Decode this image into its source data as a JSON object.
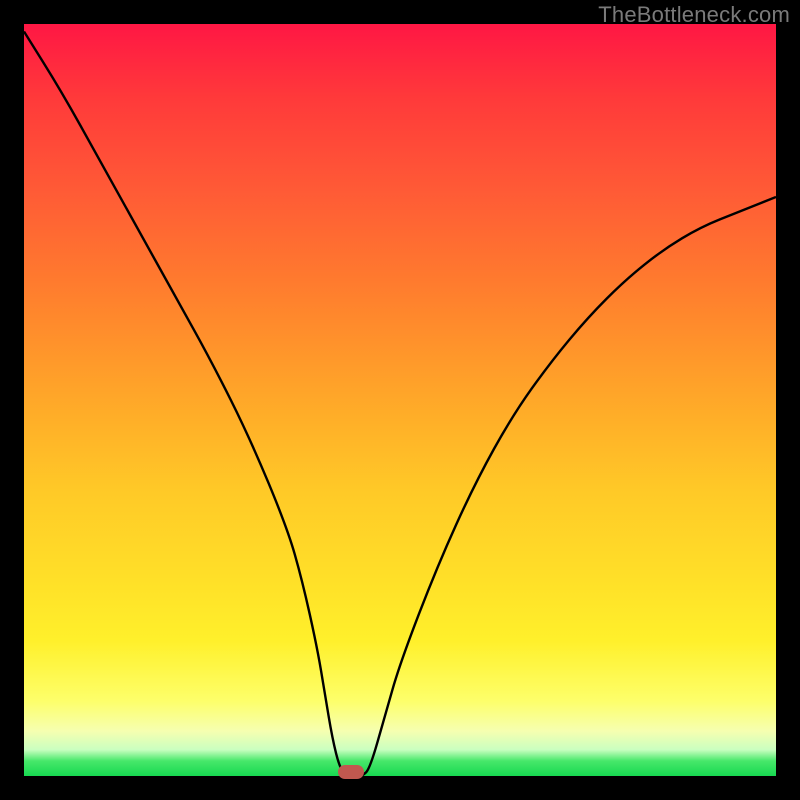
{
  "watermark": "TheBottleneck.com",
  "colors": {
    "frame": "#000000",
    "gradient_top": "#ff1744",
    "gradient_mid": "#ffe028",
    "gradient_bottom": "#17d951",
    "curve": "#000000",
    "marker": "#c1584f",
    "watermark": "#7a7a7a"
  },
  "chart_data": {
    "type": "line",
    "title": "",
    "xlabel": "",
    "ylabel": "",
    "xlim": [
      0,
      100
    ],
    "ylim": [
      0,
      100
    ],
    "x": [
      0,
      5,
      10,
      15,
      20,
      25,
      30,
      35,
      37,
      39,
      40,
      41,
      42,
      43,
      44,
      45,
      46,
      48,
      50,
      55,
      60,
      65,
      70,
      75,
      80,
      85,
      90,
      95,
      100
    ],
    "values": [
      99,
      91,
      82,
      73,
      64,
      55,
      45,
      33,
      26,
      17,
      11,
      5,
      1,
      0,
      0,
      0,
      1,
      8,
      15,
      28,
      39,
      48,
      55,
      61,
      66,
      70,
      73,
      75,
      77
    ],
    "min_point": {
      "x": 43.5,
      "y": 0
    },
    "annotations": []
  },
  "marker": {
    "x_percent": 43.5,
    "y_percent": 0.5
  }
}
